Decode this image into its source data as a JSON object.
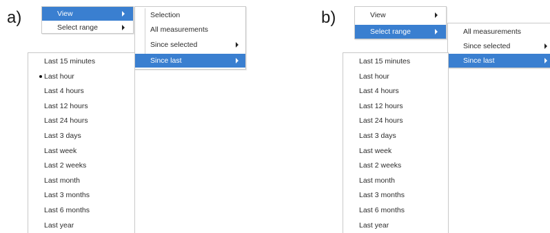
{
  "panels": {
    "a": {
      "label": "a)"
    },
    "b": {
      "label": "b)"
    }
  },
  "main_menu": {
    "view": "View",
    "select_range": "Select range"
  },
  "range_submenu": {
    "selection": "Selection",
    "all_measurements": "All measurements",
    "since_selected": "Since selected",
    "since_last": "Since last"
  },
  "since_last_submenu": {
    "items": [
      "Last 15 minutes",
      "Last hour",
      "Last 4 hours",
      "Last 12 hours",
      "Last 24 hours",
      "Last 3 days",
      "Last week",
      "Last 2 weeks",
      "Last month",
      "Last 3 months",
      "Last 6 months",
      "Last year"
    ],
    "checked_item_in_panel_a": "Last hour"
  },
  "colors": {
    "highlight": "#3a7fd0",
    "border": "#c8c8c8",
    "text": "#2b2b2b"
  }
}
